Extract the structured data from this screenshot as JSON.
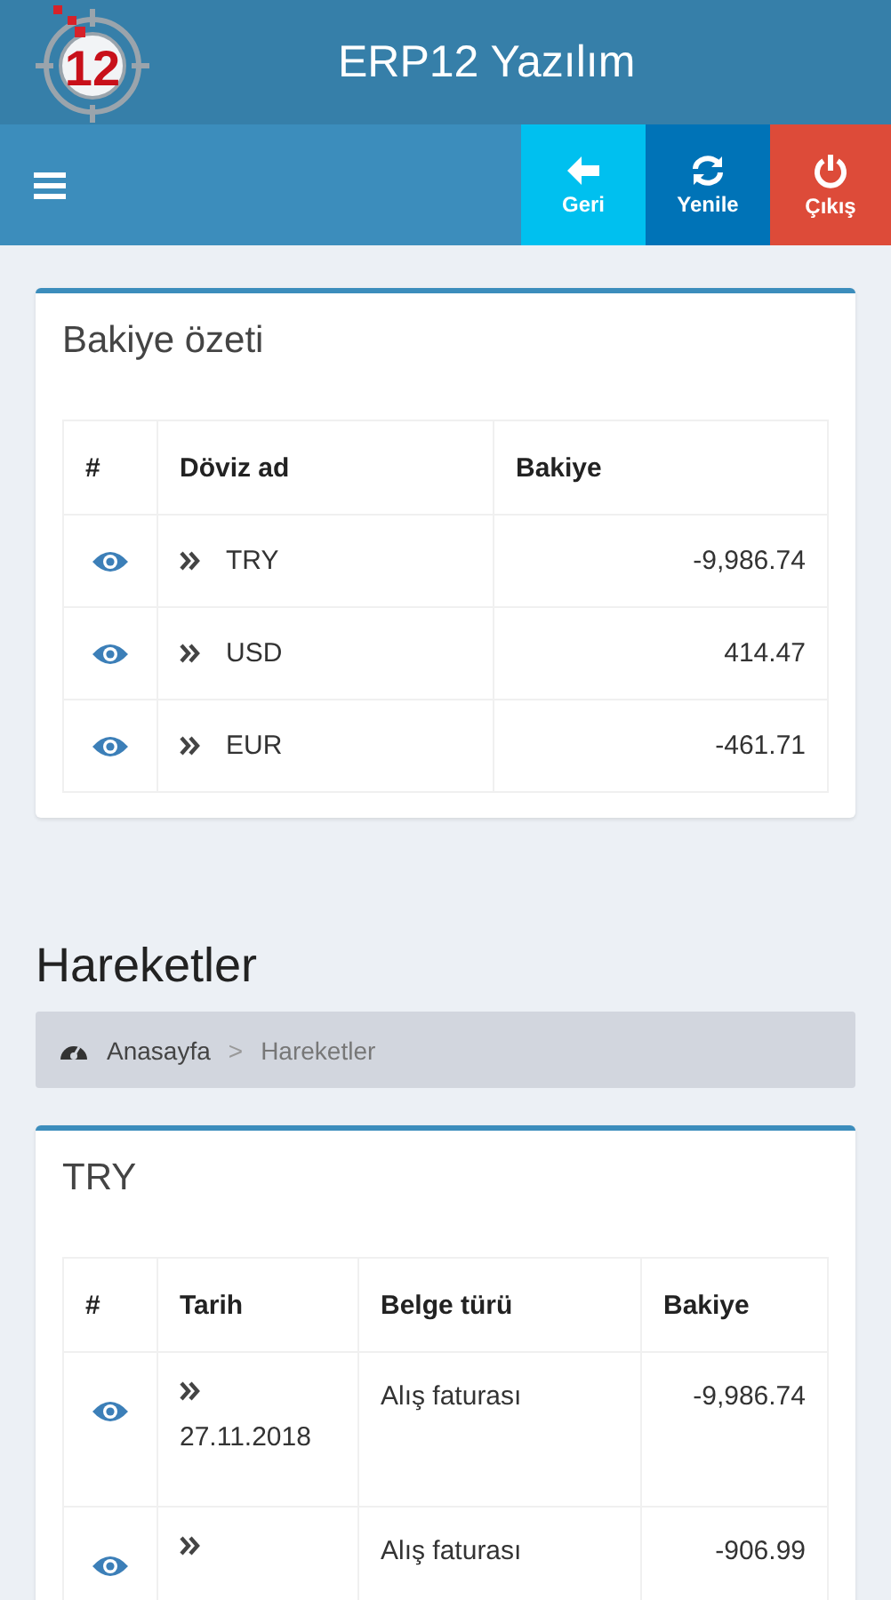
{
  "header": {
    "title": "ERP12 Yazılım",
    "logo_text": "12"
  },
  "toolbar": {
    "buttons": [
      {
        "kind": "back",
        "label": "Geri"
      },
      {
        "kind": "refresh",
        "label": "Yenile"
      },
      {
        "kind": "logout",
        "label": "Çıkış"
      }
    ]
  },
  "summary": {
    "title": "Bakiye özeti",
    "columns": [
      "#",
      "Döviz ad",
      "Bakiye"
    ],
    "rows": [
      {
        "currency": "TRY",
        "balance": "-9,986.74"
      },
      {
        "currency": "USD",
        "balance": "414.47"
      },
      {
        "currency": "EUR",
        "balance": "-461.71"
      }
    ]
  },
  "page_title": "Hareketler",
  "breadcrumb": [
    "Anasayfa",
    ">",
    "Hareketler"
  ],
  "movements": {
    "title": "TRY",
    "columns": [
      "#",
      "Tarih",
      "Belge türü",
      "Bakiye"
    ],
    "rows": [
      {
        "date": "27.11.2018",
        "document_type": "Alış faturası",
        "balance": "-9,986.74"
      },
      {
        "document_type": "Alış faturası",
        "balance": "-906.99"
      }
    ]
  }
}
